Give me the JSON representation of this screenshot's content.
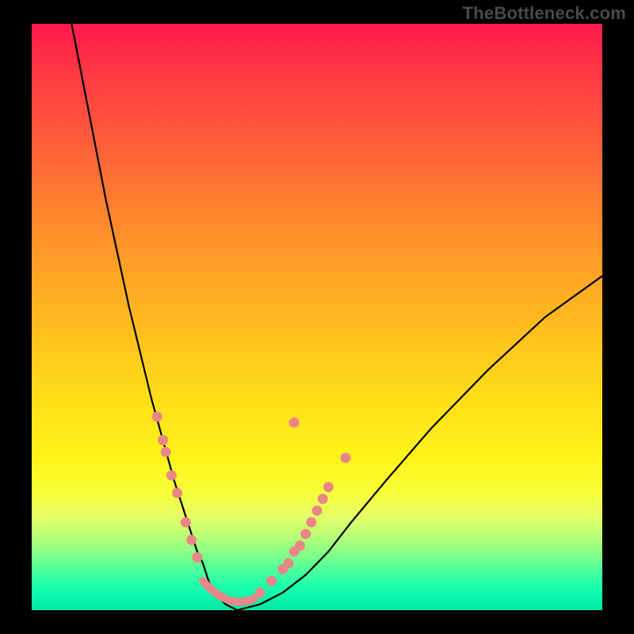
{
  "watermark": "TheBottleneck.com",
  "chart_data": {
    "type": "line",
    "title": "",
    "xlabel": "",
    "ylabel": "",
    "xlim": [
      0,
      100
    ],
    "ylim": [
      0,
      100
    ],
    "grid": false,
    "legend": false,
    "series": [
      {
        "name": "curve",
        "x": [
          7,
          9,
          11,
          13,
          15,
          17,
          19,
          21,
          23,
          25,
          27,
          28,
          29,
          30,
          31,
          32,
          33,
          34,
          36,
          40,
          44,
          48,
          52,
          56,
          62,
          70,
          80,
          90,
          100
        ],
        "y": [
          100,
          90,
          80,
          70,
          61,
          52,
          44,
          36,
          29,
          22,
          16,
          13,
          10,
          8,
          5,
          3,
          2,
          1,
          0,
          1,
          3,
          6,
          10,
          15,
          22,
          31,
          41,
          50,
          57
        ],
        "color": "#000000"
      }
    ],
    "markers": {
      "left_cluster": {
        "color": "#e98787",
        "points": [
          {
            "x": 22,
            "y": 33
          },
          {
            "x": 23,
            "y": 29
          },
          {
            "x": 23.5,
            "y": 27
          },
          {
            "x": 24.5,
            "y": 23
          },
          {
            "x": 25.5,
            "y": 20
          },
          {
            "x": 27,
            "y": 15
          },
          {
            "x": 28,
            "y": 12
          },
          {
            "x": 29,
            "y": 9
          }
        ]
      },
      "valley_band": {
        "color": "#e98787",
        "from": {
          "x": 30,
          "y": 5
        },
        "to": {
          "x": 39,
          "y": 2
        }
      },
      "right_cluster": {
        "color": "#e98787",
        "points": [
          {
            "x": 40,
            "y": 3
          },
          {
            "x": 42,
            "y": 5
          },
          {
            "x": 44,
            "y": 7
          },
          {
            "x": 45,
            "y": 8
          },
          {
            "x": 46,
            "y": 10
          },
          {
            "x": 47,
            "y": 11
          },
          {
            "x": 48,
            "y": 13
          },
          {
            "x": 49,
            "y": 15
          },
          {
            "x": 50,
            "y": 17
          },
          {
            "x": 51,
            "y": 19
          },
          {
            "x": 52,
            "y": 21
          },
          {
            "x": 55,
            "y": 26
          },
          {
            "x": 46,
            "y": 32
          }
        ]
      }
    },
    "background_gradient": {
      "top": "#ff1a4d",
      "bottom": "#00e7a5"
    }
  }
}
